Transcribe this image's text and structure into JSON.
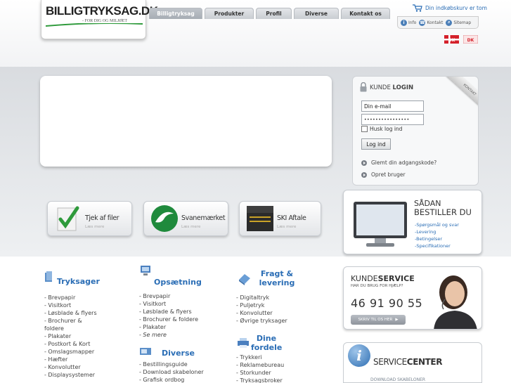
{
  "header": {
    "logo_main": "BILLIGTRYKSAG.DK",
    "logo_tagline": "- FOR DIG OG MILJØET",
    "nav": [
      {
        "label": "Billigtryksag",
        "active": true
      },
      {
        "label": "Produkter",
        "active": false
      },
      {
        "label": "Profil",
        "active": false
      },
      {
        "label": "Diverse",
        "active": false
      },
      {
        "label": "Kontakt os",
        "active": false
      }
    ],
    "cart_text": "Din indkøbskurv er tom",
    "utility": {
      "info": "Info",
      "contact": "Kontakt",
      "sitemap": "Sitemap"
    },
    "flags": [
      "DK",
      "DK"
    ]
  },
  "login": {
    "title_light": "KUNDE",
    "title_bold": "LOGIN",
    "ribbon": "KONTAKT",
    "email_placeholder": "Din e-mail",
    "password_value": "••••••••••••••••",
    "remember": "Husk log ind",
    "button": "Log ind",
    "forgot": "Glemt din adgangskode?",
    "register": "Opret bruger"
  },
  "badges": [
    {
      "title": "Tjek af filer",
      "sub": "Læs mere"
    },
    {
      "title": "Svanemærket",
      "sub": "Læs mere"
    },
    {
      "title": "SKI Aftale",
      "sub": "Læs mere"
    }
  ],
  "howto": {
    "title_line1": "SÅDAN",
    "title_line2": "BESTILLER DU",
    "links": [
      "-Spørgsmål og svar",
      "-Levering",
      "-Betingelser",
      "-Specifikationer"
    ]
  },
  "columns": {
    "tryksager": {
      "title": "Tryksager",
      "items": [
        "- Brevpapir",
        "- Visitkort",
        "- Løsblade & flyers",
        "- Brochurer &",
        "foldere",
        "- Plakater",
        "- Postkort & Kort",
        "- Omslagsmapper",
        "- Hæfter",
        "- Konvolutter",
        "- Displaysystemer"
      ]
    },
    "opsaetning": {
      "title": "Opsætning",
      "items": [
        "- Brevpapir",
        "- Visitkort",
        "- Løsblade & flyers",
        "- Brochurer & foldere",
        "- Plakater"
      ],
      "see_more": "- Se mere"
    },
    "diverse": {
      "title": "Diverse",
      "items": [
        "- Bestillingsguide",
        "- Download skabeloner",
        "- Grafisk ordbog"
      ]
    },
    "fragt": {
      "title_line1": "Fragt &",
      "title_line2": "levering",
      "items": [
        "- Digitaltryk",
        "- Puljetryk",
        "- Konvolutter",
        "- Øvrige tryksager"
      ]
    },
    "dine": {
      "title_line1": "Dine",
      "title_line2": "fordele",
      "items": [
        "- Trykkeri",
        "- Reklamebureau",
        "- Storkunder",
        "- Tryksagsbroker"
      ]
    }
  },
  "service": {
    "title_light": "KUNDE",
    "title_bold": "SERVICE",
    "subtitle": "HAR DU BRUG FOR HJÆLP?",
    "phone": "46 91 90 55",
    "button": "SKRIV TIL OS HER"
  },
  "service_center": {
    "title_light": "SERVICE",
    "title_bold": "CENTER",
    "link": "DOWNLOAD SKABELONER"
  }
}
